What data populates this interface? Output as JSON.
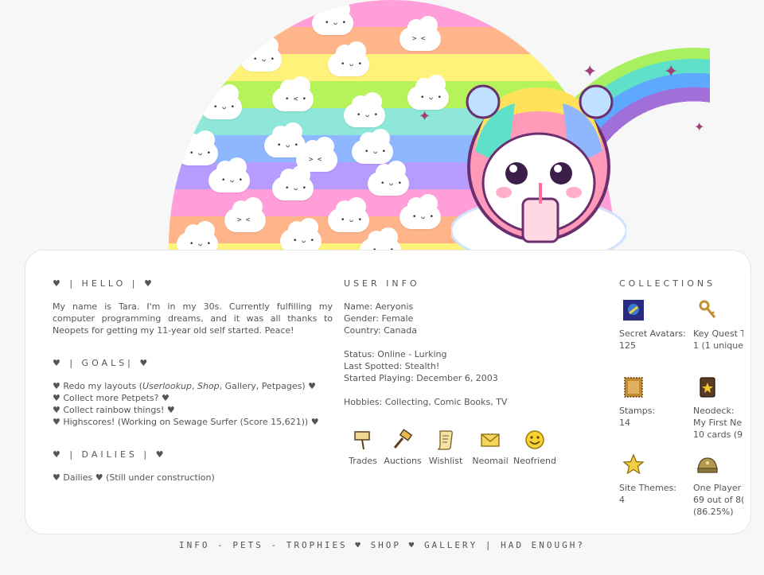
{
  "hello": {
    "heading": "♥ | HELLO | ♥",
    "text": "My name is Tara. I'm in my 30s. Currently fulfilling my computer programming dreams, and it was all thanks to Neopets for getting my 11-year old self started. Peace!"
  },
  "goals": {
    "heading": "♥ | GOALS| ♥",
    "items": [
      "♥ Redo my layouts (",
      "♥ Collect more Petpets? ♥",
      "♥ Collect rainbow things! ♥",
      "♥ Highscores! (Working on Sewage Surfer (Score 15,621)) ♥"
    ],
    "layout_userlookup": "Userlookup",
    "layout_sep1": ", ",
    "layout_shop": "Shop",
    "layout_rest": ", Gallery, Petpages) ♥"
  },
  "dailies": {
    "heading": "♥ | DAILIES | ♥",
    "text": "♥ Dailies ♥ (Still under construction)"
  },
  "user_info": {
    "heading": "USER INFO",
    "name": "Name: Aeryonis",
    "gender": "Gender: Female",
    "country": "Country: Canada",
    "status": "Status: Online - Lurking",
    "last_spotted": "Last Spotted: Stealth!",
    "started": "Started Playing: December 6, 2003",
    "hobbies": "Hobbies: Collecting, Comic Books, TV"
  },
  "actions": [
    {
      "label": "Trades",
      "icon": "signpost-icon"
    },
    {
      "label": "Auctions",
      "icon": "gavel-icon"
    },
    {
      "label": "Wishlist",
      "icon": "scroll-icon"
    },
    {
      "label": "Neomail",
      "icon": "envelope-icon"
    },
    {
      "label": "Neofriend",
      "icon": "smiley-icon"
    }
  ],
  "collections": {
    "heading": "COLLECTIONS",
    "items": [
      {
        "label": "Secret Avatars:",
        "value": "125",
        "icon": "avatar-icon"
      },
      {
        "label": "Key Quest T",
        "value": "1 (1 unique",
        "icon": "key-icon"
      },
      {
        "label": "Stamps:",
        "value": "14",
        "icon": "stamp-icon"
      },
      {
        "label": "Neodeck:",
        "value": "My First Ne",
        "extra": "10 cards (9",
        "icon": "card-deck-icon"
      },
      {
        "label": "Site Themes:",
        "value": "4",
        "icon": "star-icon"
      },
      {
        "label": "One Player",
        "value": "69 out of 8(",
        "extra": "(86.25%)",
        "icon": "helmet-icon"
      }
    ]
  },
  "footer": {
    "info": "INFO",
    "sep1": " - ",
    "pets": "PETS",
    "sep2": " - ",
    "trophies": "TROPHIES",
    "sep3": " ♥ ",
    "shop": "SHOP",
    "sep4": " ♥ ",
    "gallery": "GALLERY",
    "sep5": " | ",
    "had_enough": "HAD ENOUGH?"
  },
  "colors": {
    "card_bg": "#ffffff",
    "page_bg": "#f7f7f7",
    "text": "#555555"
  }
}
